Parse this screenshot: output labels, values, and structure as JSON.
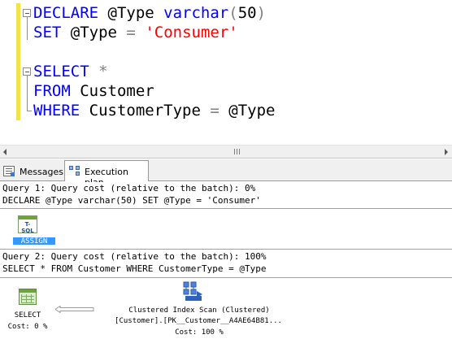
{
  "editor": {
    "lines": [
      {
        "keyword": "DECLARE",
        "rest": " @Type ",
        "type": "varchar",
        "paren_open": "(",
        "number": "50",
        "paren_close": ")"
      },
      {
        "keyword": "SET",
        "rest": " @Type ",
        "op": "=",
        "space": " ",
        "string": "'Consumer'"
      },
      {
        "keyword": "SELECT",
        "space": " ",
        "op": "*"
      },
      {
        "keyword": "FROM",
        "rest": " Customer"
      },
      {
        "keyword": "WHERE",
        "rest": " CustomerType ",
        "op": "=",
        "tail": " @Type"
      }
    ]
  },
  "tabs": {
    "messages": {
      "label": "Messages",
      "icon": "messages-icon"
    },
    "execution_plan": {
      "label": "Execution plan",
      "icon": "execution-plan-icon",
      "selected": true
    }
  },
  "plan": {
    "query1": {
      "header": "Query 1: Query cost (relative to the batch): 0%",
      "sql": "DECLARE @Type varchar(50) SET @Type = 'Consumer'",
      "operator_icon_text": "T-SQL",
      "operator_label": "ASSIGN"
    },
    "query2": {
      "header": "Query 2: Query cost (relative to the batch): 100%",
      "sql": "SELECT * FROM Customer WHERE CustomerType = @Type",
      "select_label": "SELECT",
      "select_cost": "Cost: 0 %",
      "scan_title": "Clustered Index Scan (Clustered)",
      "scan_object": "[Customer].[PK__Customer__A4AE64B81...",
      "scan_cost": "Cost: 100 %"
    }
  },
  "colors": {
    "keyword": "#0000ff",
    "string": "#ff0000",
    "operator": "#808080",
    "selection": "#3399ff",
    "change_margin": "#f2e34b"
  }
}
